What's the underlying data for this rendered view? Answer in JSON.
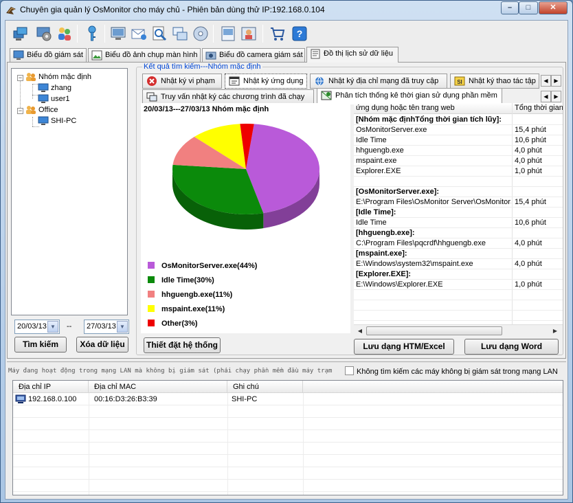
{
  "window": {
    "title": "Chuyên gia quản lý OsMonitor cho máy chủ - Phiên bản dùng thử IP:192.168.0.104",
    "min_label": "–",
    "max_label": "□",
    "close_label": "✕"
  },
  "toolbar": {
    "icons": [
      "computers-icon",
      "settings-icon",
      "users-icon",
      "key-icon",
      "monitor-icon",
      "mail-icon",
      "search-doc-icon",
      "windows-icon",
      "disc-icon",
      "screen-icon",
      "user-card-icon",
      "cart-icon",
      "help-icon"
    ]
  },
  "main_tabs": [
    {
      "label": "Biểu đồ giám sát"
    },
    {
      "label": "Biểu đồ ảnh chụp màn hình"
    },
    {
      "label": "Biểu đồ camera giám sát"
    },
    {
      "label": "Đồ thị lịch sử dữ liệu"
    }
  ],
  "tree": {
    "root1": "Nhóm mặc định",
    "children1": [
      "zhang",
      "user1"
    ],
    "root2": "Office",
    "children2": [
      "SHI-PC"
    ]
  },
  "date_from": "20/03/13",
  "date_sep": "--",
  "date_to": "27/03/13",
  "buttons": {
    "search": "Tìm kiếm",
    "delete_data": "Xóa dữ liệu",
    "system_settings": "Thiết đặt hệ thống",
    "save_html": "Lưu dạng HTM/Excel",
    "save_word": "Lưu dạng Word"
  },
  "result_group_label": "Kết quả tìm kiếm---Nhóm mặc định",
  "sub_tabs_row1": [
    {
      "label": "Nhật ký vi phạm"
    },
    {
      "label": "Nhật ký ứng dụng"
    },
    {
      "label": "Nhật ký địa chỉ mạng đã truy cập"
    },
    {
      "label": "Nhật ký thao tác tập"
    }
  ],
  "sub_tabs_row2": [
    {
      "label": "Truy vấn nhật ký các chương trình đã chạy"
    },
    {
      "label": "Phân tích thống kê thời gian sử dụng phần mềm"
    }
  ],
  "chart_data": {
    "type": "pie",
    "title": "20/03/13---27/03/13  Nhóm mặc định",
    "categories": [
      "OsMonitorServer.exe(44%)",
      "Idle Time(30%)",
      "hhguengb.exe(11%)",
      "mspaint.exe(11%)",
      "Other(3%)"
    ],
    "values": [
      44,
      30,
      11,
      11,
      3
    ],
    "colors": [
      "#b95ad9",
      "#0b8a0b",
      "#f18080",
      "#ffff00",
      "#ee0000"
    ]
  },
  "grid": {
    "headers": [
      "ứng dụng hoặc tên trang web",
      "Tổng thời gian."
    ],
    "rows": [
      {
        "name": "[Nhóm mặc địnhTổng thời gian tích lũy]:",
        "time": "",
        "bold": true
      },
      {
        "name": "OsMonitorServer.exe",
        "time": "15,4 phút",
        "bold": false
      },
      {
        "name": "Idle Time",
        "time": "10,6 phút",
        "bold": false
      },
      {
        "name": "hhguengb.exe",
        "time": "4,0 phút",
        "bold": false
      },
      {
        "name": "mspaint.exe",
        "time": "4,0 phút",
        "bold": false
      },
      {
        "name": "Explorer.EXE",
        "time": "1,0 phút",
        "bold": false
      },
      {
        "name": "",
        "time": "",
        "bold": false
      },
      {
        "name": "[OsMonitorServer.exe]:",
        "time": "",
        "bold": true
      },
      {
        "name": "E:\\Program Files\\OsMonitor Server\\OsMonitorServer.exe",
        "time": "15,4 phút",
        "bold": false
      },
      {
        "name": "[Idle Time]:",
        "time": "",
        "bold": true
      },
      {
        "name": "Idle Time",
        "time": "10,6 phút",
        "bold": false
      },
      {
        "name": "[hhguengb.exe]:",
        "time": "",
        "bold": true
      },
      {
        "name": "C:\\Program Files\\pqcrdf\\hhguengb.exe",
        "time": "4,0 phút",
        "bold": false
      },
      {
        "name": "[mspaint.exe]:",
        "time": "",
        "bold": true
      },
      {
        "name": "E:\\Windows\\system32\\mspaint.exe",
        "time": "4,0 phút",
        "bold": false
      },
      {
        "name": "[Explorer.EXE]:",
        "time": "",
        "bold": true
      },
      {
        "name": "E:\\Windows\\Explorer.EXE",
        "time": "1,0 phút",
        "bold": false
      },
      {
        "name": "",
        "time": "",
        "bold": false
      },
      {
        "name": "",
        "time": "",
        "bold": false
      },
      {
        "name": "",
        "time": "",
        "bold": false
      }
    ]
  },
  "bottom": {
    "label": "Máy đang hoạt động trong mạng LAN mà không bị giám sát (phải chạy phần mềm đầu máy trạm",
    "checkbox_label": "Không tìm kiếm các máy không bị giám sát trong mạng LAN",
    "headers": [
      "Địa chỉ IP",
      "Địa chỉ MAC",
      "Ghi chú"
    ],
    "rows": [
      {
        "ip": "192.168.0.100",
        "mac": "00:16:D3:26:B3:39",
        "note": "SHI-PC"
      }
    ]
  }
}
